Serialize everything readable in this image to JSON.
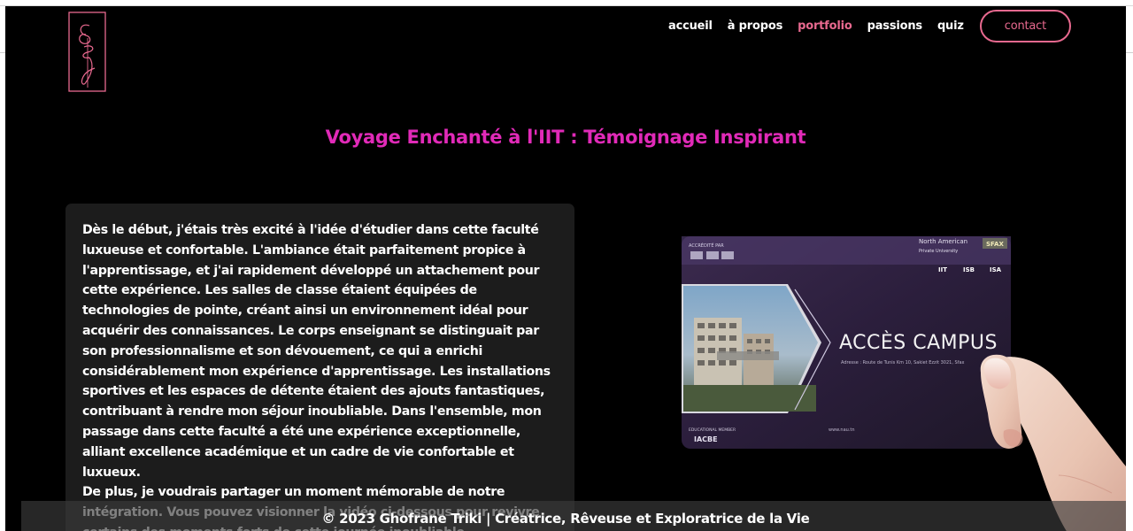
{
  "nav": {
    "items": [
      {
        "label": "accueil"
      },
      {
        "label": "à propos"
      },
      {
        "label": "portfolio"
      },
      {
        "label": "passions"
      },
      {
        "label": "quiz"
      }
    ],
    "contact_label": "contact"
  },
  "main": {
    "heading": "Voyage Enchanté à l'IIT : Témoignage Inspirant",
    "paragraph1": "Dès le début, j'étais très excité à l'idée d'étudier dans cette faculté luxueuse et confortable. L'ambiance était parfaitement propice à l'apprentissage, et j'ai rapidement développé un attachement pour cette expérience. Les salles de classe étaient équipées de technologies de pointe, créant ainsi un environnement idéal pour acquérir des connaissances. Le corps enseignant se distinguait par son professionnalisme et son dévouement, ce qui a enrichi considérablement mon expérience d'apprentissage. Les installations sportives et les espaces de détente étaient des ajouts fantastiques, contribuant à rendre mon séjour inoubliable. Dans l'ensemble, mon passage dans cette faculté a été une expérience exceptionnelle, alliant excellence académique et un cadre de vie confortable et luxueux.",
    "paragraph2": "De plus, je voudrais partager un moment mémorable de notre intégration. Vous pouvez visionner la vidéo ci-dessous pour revivre certains des moments forts de cette journée inoubliable."
  },
  "card": {
    "accredited": "ACCRÉDITÉ PAR",
    "university_line1": "North American",
    "university_line2": "Private University",
    "city": "SFAX",
    "logos": [
      "IIT",
      "ISB",
      "ISA"
    ],
    "title": "ACCÈS CAMPUS",
    "address": "Adresse : Route de Tunis Km 10, Sakiet Ezzit 3021, Sfax",
    "educational_member": "EDUCATIONAL MEMBER",
    "iacbe": "IACBE",
    "website": "www.nau.tn"
  },
  "footer": {
    "text": "© 2023 Ghofrane Triki | Créatrice, Rêveuse et Exploratrice de la Vie"
  },
  "colors": {
    "accent_pink": "#e8698f",
    "heading_magenta": "#e12ab8",
    "background": "#000000",
    "card_bg": "#1c1c1c"
  },
  "icons": [
    "logo-monogram"
  ]
}
